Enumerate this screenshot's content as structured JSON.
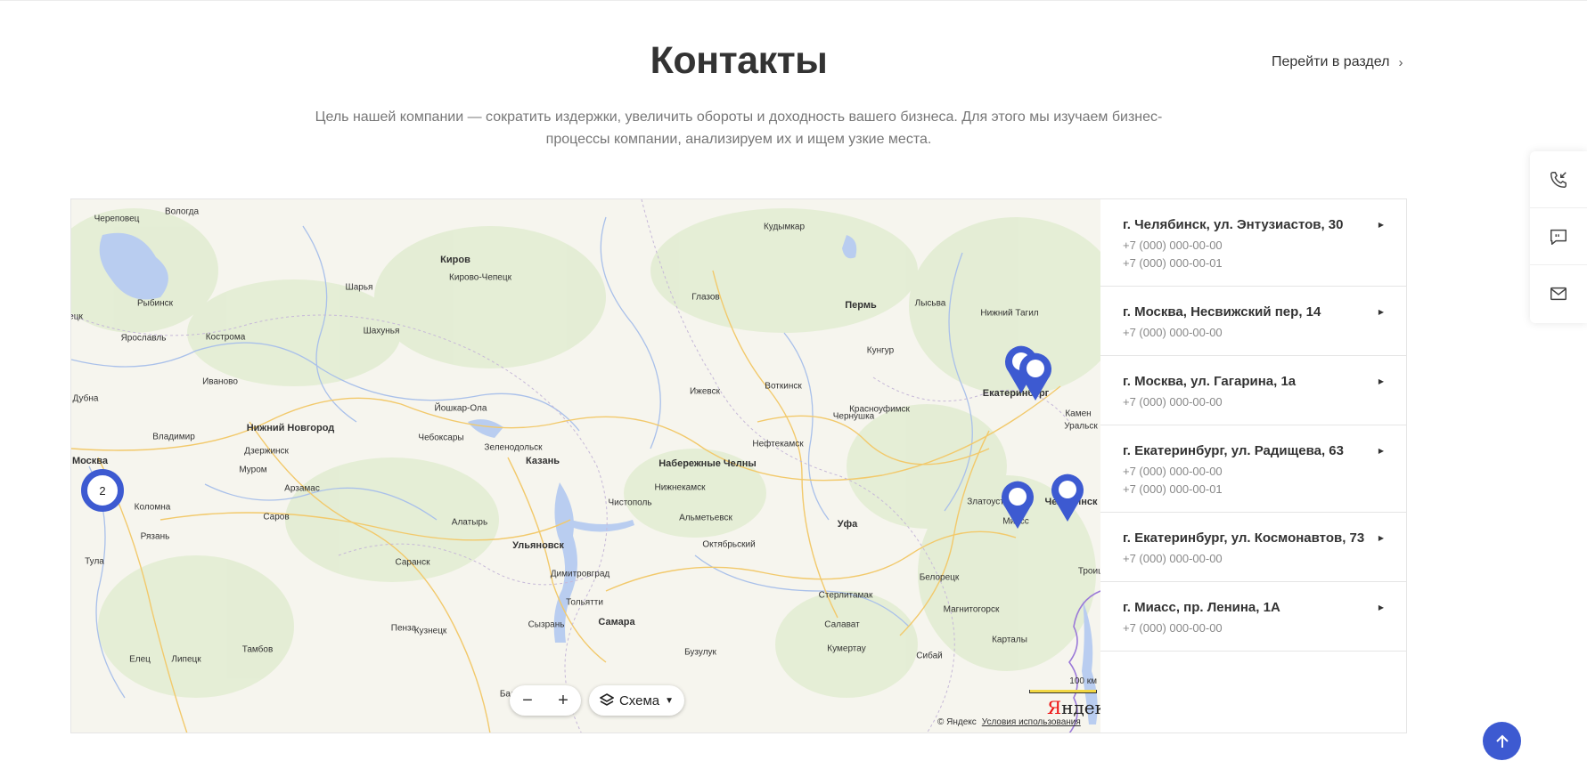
{
  "header": {
    "title": "Контакты",
    "go_link": "Перейти в раздел",
    "lead": "Цель нашей компании — сократить издержки, увеличить обороты и доходность вашего бизнеса. Для этого мы изучаем бизнес-процессы компании, анализируем их и ищем узкие места."
  },
  "map": {
    "cities": [
      {
        "name": "Череповец",
        "cls": ""
      },
      {
        "name": "Вологда",
        "cls": ""
      },
      {
        "name": "Рыбинск",
        "cls": ""
      },
      {
        "name": "Ярославль",
        "cls": ""
      },
      {
        "name": "Кострома",
        "cls": ""
      },
      {
        "name": "Иваново",
        "cls": ""
      },
      {
        "name": "Дубна",
        "cls": ""
      },
      {
        "name": "Владимир",
        "cls": ""
      },
      {
        "name": "Москва",
        "cls": "mid"
      },
      {
        "name": "Коломна",
        "cls": ""
      },
      {
        "name": "Рязань",
        "cls": ""
      },
      {
        "name": "Тула",
        "cls": ""
      },
      {
        "name": "Елец",
        "cls": ""
      },
      {
        "name": "Липецк",
        "cls": ""
      },
      {
        "name": "Тамбов",
        "cls": ""
      },
      {
        "name": "Муром",
        "cls": ""
      },
      {
        "name": "Арзамас",
        "cls": ""
      },
      {
        "name": "Саров",
        "cls": ""
      },
      {
        "name": "Нижний Новгород",
        "cls": "mid"
      },
      {
        "name": "Дзержинск",
        "cls": ""
      },
      {
        "name": "Шарья",
        "cls": ""
      },
      {
        "name": "Шахунья",
        "cls": ""
      },
      {
        "name": "Киров",
        "cls": "mid"
      },
      {
        "name": "Кирово-Чепецк",
        "cls": ""
      },
      {
        "name": "Йошкар-Ола",
        "cls": ""
      },
      {
        "name": "Чебоксары",
        "cls": ""
      },
      {
        "name": "Зеленодольск",
        "cls": ""
      },
      {
        "name": "Казань",
        "cls": "mid"
      },
      {
        "name": "Алатырь",
        "cls": ""
      },
      {
        "name": "Саранск",
        "cls": ""
      },
      {
        "name": "Пенза",
        "cls": ""
      },
      {
        "name": "Кузнецк",
        "cls": ""
      },
      {
        "name": "Ульяновск",
        "cls": "mid"
      },
      {
        "name": "Димитровград",
        "cls": ""
      },
      {
        "name": "Тольятти",
        "cls": ""
      },
      {
        "name": "Сызрань",
        "cls": ""
      },
      {
        "name": "Самара",
        "cls": "mid"
      },
      {
        "name": "Чистополь",
        "cls": ""
      },
      {
        "name": "Набережные Челны",
        "cls": "mid"
      },
      {
        "name": "Нижнекамск",
        "cls": ""
      },
      {
        "name": "Альметьевск",
        "cls": ""
      },
      {
        "name": "Октябрьский",
        "cls": ""
      },
      {
        "name": "Бузулук",
        "cls": ""
      },
      {
        "name": "Балаково",
        "cls": ""
      },
      {
        "name": "Глазов",
        "cls": ""
      },
      {
        "name": "Ижевск",
        "cls": ""
      },
      {
        "name": "Воткинск",
        "cls": ""
      },
      {
        "name": "Нефтекамск",
        "cls": ""
      },
      {
        "name": "Пермь",
        "cls": "mid"
      },
      {
        "name": "Кудымкар",
        "cls": ""
      },
      {
        "name": "Лысьва",
        "cls": ""
      },
      {
        "name": "Кунгур",
        "cls": ""
      },
      {
        "name": "Чернушка",
        "cls": ""
      },
      {
        "name": "Красноуфимск",
        "cls": ""
      },
      {
        "name": "Уфа",
        "cls": "mid"
      },
      {
        "name": "Стерлитамак",
        "cls": ""
      },
      {
        "name": "Салават",
        "cls": ""
      },
      {
        "name": "Кумертау",
        "cls": ""
      },
      {
        "name": "Белорецк",
        "cls": ""
      },
      {
        "name": "Магнитогорск",
        "cls": ""
      },
      {
        "name": "Сибай",
        "cls": ""
      },
      {
        "name": "Карталы",
        "cls": ""
      },
      {
        "name": "Нижний Тагил",
        "cls": ""
      },
      {
        "name": "Екатеринбург",
        "cls": "mid"
      },
      {
        "name": "Камен",
        "cls": ""
      },
      {
        "name": "Уральск",
        "cls": ""
      },
      {
        "name": "Златоуст",
        "cls": ""
      },
      {
        "name": "Миасс",
        "cls": ""
      },
      {
        "name": "Челябинск",
        "cls": "mid"
      },
      {
        "name": "Троицк",
        "cls": ""
      },
      {
        "name": "ецк",
        "cls": ""
      }
    ],
    "cluster_count": "2",
    "layer_label": "Схема",
    "scale_label": "100 км",
    "logo_y": "Я",
    "logo_rest": "ндекс",
    "copyright": "© Яндекс",
    "terms": "Условия использования",
    "colors": {
      "pin": "#3d5ad1"
    }
  },
  "offices": [
    {
      "address": "г. Челябинск, ул. Энтузиастов, 30",
      "phones": [
        "+7 (000) 000-00-00",
        "+7 (000) 000-00-01"
      ]
    },
    {
      "address": "г. Москва, Несвижский пер, 14",
      "phones": [
        "+7 (000) 000-00-00"
      ]
    },
    {
      "address": "г. Москва, ул. Гагарина, 1а",
      "phones": [
        "+7 (000) 000-00-00"
      ]
    },
    {
      "address": "г. Екатеринбург, ул. Радищева, 63",
      "phones": [
        "+7 (000) 000-00-00",
        "+7 (000) 000-00-01"
      ]
    },
    {
      "address": "г. Екатеринбург, ул. Космонавтов, 73",
      "phones": [
        "+7 (000) 000-00-00"
      ]
    },
    {
      "address": "г. Миасс, пр. Ленина, 1А",
      "phones": [
        "+7 (000) 000-00-00"
      ]
    }
  ],
  "side_widget": {
    "icons": [
      "callback-icon",
      "chat-icon",
      "mail-icon"
    ]
  },
  "colors": {
    "accent": "#3d5ad1"
  }
}
